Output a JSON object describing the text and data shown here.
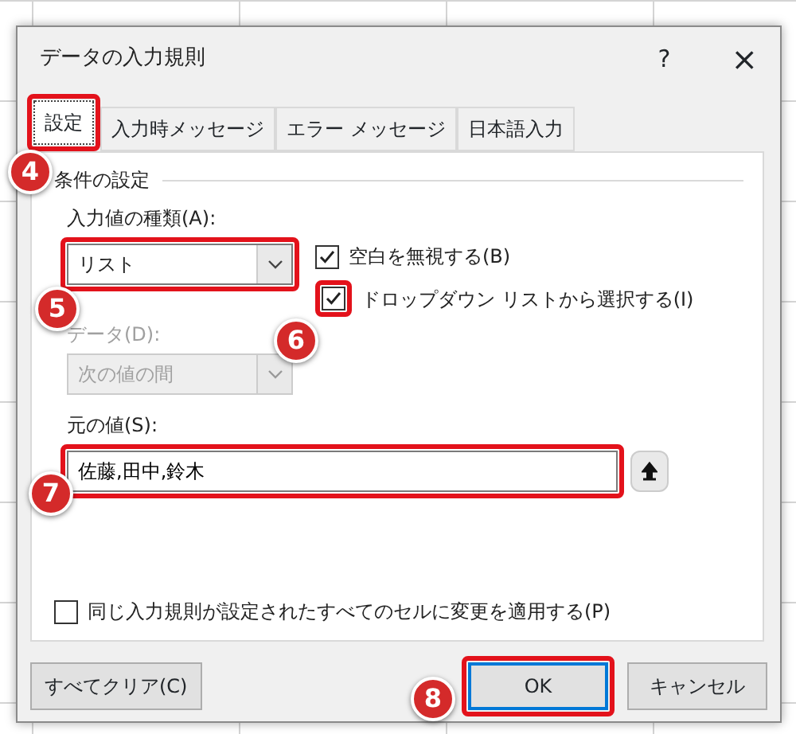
{
  "window": {
    "title": "データの入力規則",
    "help": "?",
    "close": "×"
  },
  "tabs": [
    {
      "label": "設定",
      "selected": true,
      "highlighted": true
    },
    {
      "label": "入力時メッセージ",
      "selected": false,
      "highlighted": false
    },
    {
      "label": "エラー メッセージ",
      "selected": false,
      "highlighted": false
    },
    {
      "label": "日本語入力",
      "selected": false,
      "highlighted": false
    }
  ],
  "group": {
    "title": "条件の設定"
  },
  "allow": {
    "label": "入力値の種類(A):",
    "value": "リスト",
    "highlighted": true
  },
  "options": [
    {
      "label": "空白を無視する(B)",
      "checked": true,
      "highlighted": false
    },
    {
      "label": "ドロップダウン リストから選択する(I)",
      "checked": true,
      "highlighted": true
    }
  ],
  "data": {
    "label": "データ(D):",
    "value": "次の値の間",
    "disabled": true
  },
  "source": {
    "label": "元の値(S):",
    "value": "佐藤,田中,鈴木",
    "highlighted": true
  },
  "apply_all": {
    "label": "同じ入力規則が設定されたすべてのセルに変更を適用する(P)",
    "checked": false
  },
  "buttons": [
    {
      "label": "すべてクリア(C)",
      "kind": "clear",
      "highlighted": false
    },
    {
      "label": "OK",
      "kind": "default",
      "highlighted": true
    },
    {
      "label": "キャンセル",
      "kind": "cancel",
      "highlighted": false
    }
  ],
  "step_markers": [
    {
      "label": "4"
    },
    {
      "label": "5"
    },
    {
      "label": "6"
    },
    {
      "label": "7"
    },
    {
      "label": "8"
    }
  ]
}
